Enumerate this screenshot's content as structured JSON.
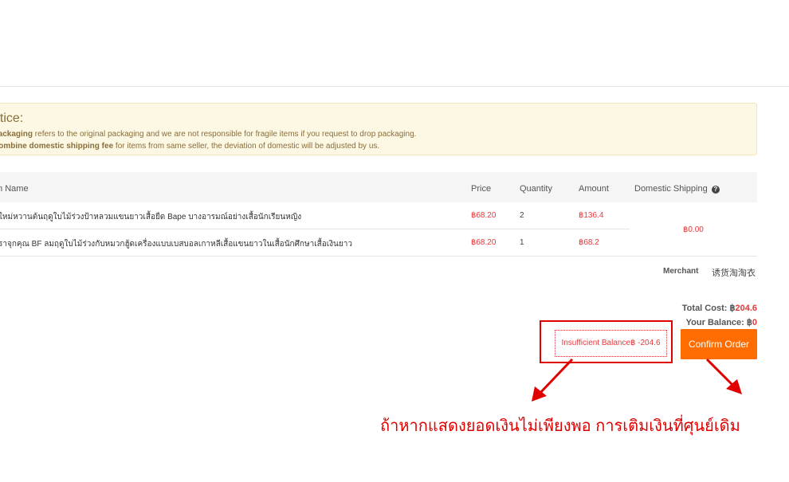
{
  "notice": {
    "title": "otice:",
    "line1_bold": "Packaging",
    "line1_rest": " refers to the original packaging and we are not responsible for fragile items if you request to drop packaging.",
    "line2_bold": "Combine domestic shipping fee",
    "line2_rest": " for items from same seller, the deviation of domestic will be adjusted by us."
  },
  "table": {
    "headers": {
      "name": "m Name",
      "price": "Price",
      "quantity": "Quantity",
      "amount": "Amount",
      "domestic_shipping": "Domestic Shipping"
    },
    "rows": [
      {
        "name": "ใหม่หวานต้นฤดูใบไม้ร่วงป้าหลวมแขนยาวเสื้อยืด Bape บางอารมณ์อย่างเสื้อนักเรียนหญิง",
        "price": "฿68.20",
        "quantity": "2",
        "amount": "฿136.4"
      },
      {
        "name": "ราจุกคุณ BF ลมฤดูใบไม้ร่วงกับหมวกฮู้ดเครื่องแบบเบสบอลเกาหลีเสื้อแขนยาวในเสื้อนักศึกษาเสื้อเงินยาว",
        "price": "฿68.20",
        "quantity": "1",
        "amount": "฿68.2"
      }
    ],
    "domestic_shipping_value": "฿0.00"
  },
  "merchant": {
    "label": "Merchant",
    "value": "诱货淘淘衣"
  },
  "summary": {
    "total_label": "Total Cost: ",
    "total_currency": "฿",
    "total_value": "204.6",
    "balance_label": "Your Balance: ",
    "balance_currency": "฿",
    "balance_value": "0"
  },
  "insufficient_text": "Insufficient Balance฿ -204.6",
  "confirm_label": "Confirm Order",
  "annotation_text": "ถ้าหากแสดงยอดเงินไม่เพียงพอ การเติมเงินที่ศุนย์เดิม",
  "colors": {
    "accent": "#ff6d00",
    "price_red": "#e4393c",
    "annotation_red": "#e00000",
    "notice_bg": "#fcf8e3"
  }
}
